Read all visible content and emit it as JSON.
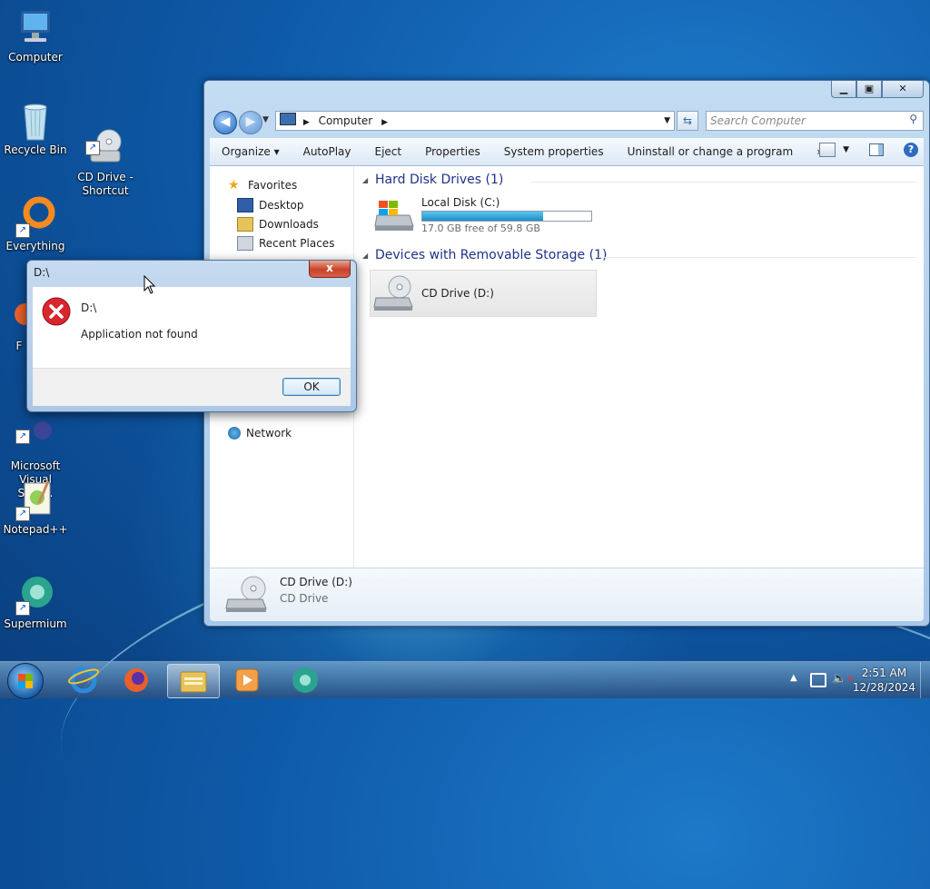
{
  "desktop": {
    "icons": [
      {
        "label": "Computer"
      },
      {
        "label": "Recycle Bin"
      },
      {
        "label": "CD Drive -\nShortcut"
      },
      {
        "label": "Everything"
      },
      {
        "label": "F"
      },
      {
        "label": "Microsoft\nVisual Stud..."
      },
      {
        "label": "Notepad++"
      },
      {
        "label": "Supermium"
      }
    ]
  },
  "explorer": {
    "address_crumb": "Computer",
    "search_placeholder": "Search Computer",
    "toolbar": [
      "Organize",
      "AutoPlay",
      "Eject",
      "Properties",
      "System properties",
      "Uninstall or change a program",
      "»"
    ],
    "nav": {
      "favorites": "Favorites",
      "desktop": "Desktop",
      "downloads": "Downloads",
      "recent": "Recent Places",
      "network": "Network"
    },
    "groups": {
      "hdd_header": "Hard Disk Drives (1)",
      "removable_header": "Devices with Removable Storage (1)"
    },
    "local_disk": {
      "name": "Local Disk (C:)",
      "free_text": "17.0 GB free of 59.8 GB",
      "used_fraction": 0.716
    },
    "cd_drive": {
      "name": "CD Drive (D:)"
    },
    "details": {
      "name": "CD Drive (D:)",
      "type": "CD Drive"
    }
  },
  "dialog": {
    "title": "D:\\",
    "heading": "D:\\",
    "message": "Application not found",
    "ok_label": "OK",
    "close_label": "x"
  },
  "taskbar": {
    "time": "2:51 AM",
    "date": "12/28/2024"
  }
}
